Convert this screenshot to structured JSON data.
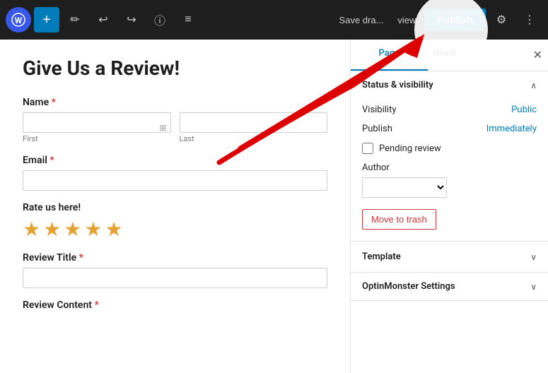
{
  "toolbar": {
    "wp_logo": "W",
    "add_label": "+",
    "pencil_icon": "✏",
    "undo_icon": "↩",
    "redo_icon": "↪",
    "info_icon": "ⓘ",
    "list_icon": "≡",
    "save_draft_label": "Save dra...",
    "preview_label": "view",
    "publish_label": "Publish",
    "settings_icon": "⚙",
    "more_icon": "⋮"
  },
  "editor": {
    "page_title": "Give Us a Review!",
    "name_label": "Name",
    "name_first_placeholder": "",
    "name_last_placeholder": "",
    "name_first_sublabel": "First",
    "name_last_sublabel": "Last",
    "email_label": "Email",
    "email_placeholder": "",
    "rate_label": "Rate us here!",
    "stars": [
      "★",
      "★",
      "★",
      "★",
      "★"
    ],
    "review_title_label": "Review Title",
    "review_title_placeholder": "",
    "review_content_label": "Review Content"
  },
  "sidebar": {
    "tab_page": "Page",
    "tab_block": "...",
    "close_icon": "✕",
    "status_visibility_title": "Status & visibility",
    "visibility_label": "Visibility",
    "visibility_value": "Public",
    "publish_label": "Publish",
    "publish_value": "Immediately",
    "pending_review_label": "Pending review",
    "author_label": "Author",
    "author_select_placeholder": "",
    "trash_btn_label": "Move to trash",
    "template_title": "Template",
    "template_chevron": "∨",
    "optinmonster_title": "OptinMonster Settings",
    "optinmonster_chevron": "∨",
    "status_chevron": "∧"
  },
  "colors": {
    "accent_blue": "#007cba",
    "star_color": "#e4a233",
    "trash_red": "#d63638",
    "toolbar_bg": "#1e1e1e"
  }
}
